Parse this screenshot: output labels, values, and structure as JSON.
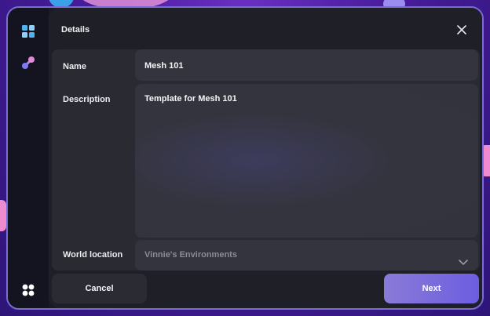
{
  "header": {
    "title": "Details"
  },
  "form": {
    "name_label": "Name",
    "name_value": "Mesh 101",
    "description_label": "Description",
    "description_value": "Template for Mesh 101",
    "location_label": "World location",
    "location_value": "Vinnie's Environments"
  },
  "buttons": {
    "cancel": "Cancel",
    "next": "Next"
  },
  "icons": {
    "rail_top": "layout-grid-icon",
    "rail_second": "mesh-link-icon",
    "rail_bottom": "apps-icon",
    "close": "close-icon",
    "chevron": "chevron-down-icon"
  },
  "colors": {
    "accent": "#6c5ee0",
    "accent_light": "#8a7ad8",
    "border": "#7a6bd6"
  }
}
